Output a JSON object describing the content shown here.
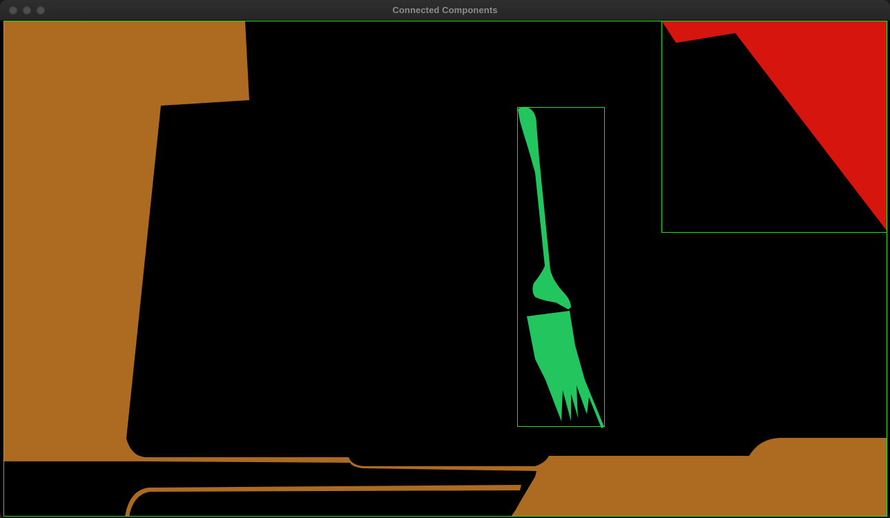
{
  "window": {
    "title": "Connected Components"
  },
  "colors": {
    "background": "#000000",
    "box_outline": "#22e022",
    "component_brown": "#ad6b22",
    "component_green": "#22c55e",
    "component_red": "#d7150f",
    "titlebar": "#2a2a2a",
    "title_text": "#8a8a8a"
  },
  "components": [
    {
      "label": "table-region",
      "color": "brown"
    },
    {
      "label": "fork",
      "color": "green",
      "bounded": true
    },
    {
      "label": "corner-region",
      "color": "red",
      "bounded": true
    }
  ]
}
